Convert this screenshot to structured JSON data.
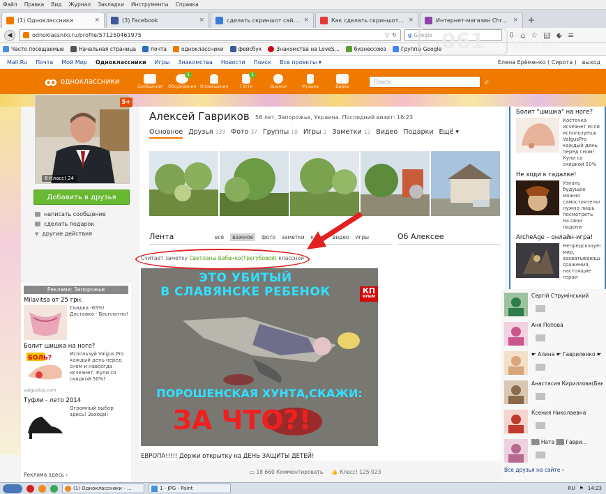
{
  "menubar": [
    "Файл",
    "Правка",
    "Вид",
    "Журнал",
    "Закладки",
    "Инструменты",
    "Справка"
  ],
  "tabs": [
    {
      "label": "(1) Одноклассники",
      "color": "#f07a00",
      "active": true
    },
    {
      "label": "(3) Facebook",
      "color": "#3b5998"
    },
    {
      "label": "сделать скриншот сайта це...",
      "color": "#3a7bd5"
    },
    {
      "label": "Как сделать скриншот цело...",
      "color": "#e53935"
    },
    {
      "label": "Интернет-магазин Chrome - ...",
      "color": "#8e44ad"
    }
  ],
  "navbar": {
    "url": "odnoklassniki.ru/profile/571250461975",
    "search_placeholder": "Google"
  },
  "bookmarks": [
    {
      "label": "Часто посещаемые",
      "color": "#4a90d9"
    },
    {
      "label": "Начальная страница",
      "color": "#555"
    },
    {
      "label": "почта",
      "color": "#2a6ac0"
    },
    {
      "label": "одноклассники",
      "color": "#f07a00"
    },
    {
      "label": "фейсбук",
      "color": "#3b5998"
    },
    {
      "label": "Знакомства на LoveS...",
      "color": "#d0021b"
    },
    {
      "label": "бизнессоюз",
      "color": "#5a9e2f"
    },
    {
      "label": "Группы Google",
      "color": "#4285f4"
    }
  ],
  "watermark": {
    "logo": "061",
    "line1": "Сайт міста",
    "line2": "Запоріжжя"
  },
  "oktop": {
    "links": [
      "Mail.Ru",
      "Почта",
      "Мой Мир",
      "Одноклассники",
      "Игры",
      "Знакомства",
      "Новости",
      "Поиск",
      "Все проекты ▾"
    ],
    "user": "Елена Ерёменко ( Сирота )",
    "logout": "выход"
  },
  "okbar": {
    "logo": "одноклассники",
    "icons": [
      {
        "label": "Сообщения",
        "badge": ""
      },
      {
        "label": "Обсуждения",
        "badge": "1"
      },
      {
        "label": "Оповещения",
        "badge": ""
      },
      {
        "label": "Гости",
        "badge": "1"
      },
      {
        "label": "Оценки",
        "badge": ""
      },
      {
        "label": "Музыка",
        "badge": ""
      },
      {
        "label": "Видео",
        "badge": ""
      }
    ],
    "search_placeholder": "Поиск"
  },
  "profile": {
    "name": "Алексей Гавриков",
    "info": "58 лет, Запорожье, Украина. Последний визит: 16:23",
    "class_count": "8 Класс! 24",
    "badge": "5+",
    "add_friend": "Добавить в друзья",
    "actions": [
      "написать сообщение",
      "сделать подарок",
      "другие действия"
    ],
    "tabs": [
      {
        "label": "Основное",
        "count": ""
      },
      {
        "label": "Друзья",
        "count": "139"
      },
      {
        "label": "Фото",
        "count": "37"
      },
      {
        "label": "Группы",
        "count": "10"
      },
      {
        "label": "Игры",
        "count": "2"
      },
      {
        "label": "Заметки",
        "count": "12"
      },
      {
        "label": "Видео",
        "count": ""
      },
      {
        "label": "Подарки",
        "count": ""
      },
      {
        "label": "Ещё ▾",
        "count": ""
      }
    ]
  },
  "feed": {
    "title": "Лента",
    "filters": [
      "всё",
      "важное",
      "фото",
      "заметки",
      "класс",
      "видео",
      "игры"
    ],
    "about": "Об Алексее",
    "note_prefix": "Считает заметку ",
    "note_name": "Светланы Бабенко(Трегубовой)",
    "note_suffix": " классной",
    "post_text1": "ЭТО УБИТЫЙ",
    "post_text2": "В СЛАВЯНСКЕ РЕБЕНОК",
    "post_text3": "ПОРОШЕНСКАЯ ХУНТА,СКАЖИ:",
    "post_text4": "ЗА ЧТО?!",
    "kp_logo": "КП",
    "kp_sub": "КРЫМ",
    "caption": "ЕВРОПА!!!!! Держи открытку на ДЕНЬ ЗАЩИТЫ ДЕТЕЙ!",
    "comments": "18 660 Комментировать",
    "likes": "Класс! 125 023"
  },
  "left_ads": {
    "header": "Реклама: Запорожье",
    "items": [
      {
        "title": "Milavitsa от 25 грн.",
        "text": "Скидка -65%! Доставка - Бесплатно!",
        "color": "#e9a7b8"
      },
      {
        "title": "Болит шишка на ноге?",
        "text": "Используй Valgus Pro каждый день перед сном и навсегда исчезнет. Купи со скидкой 50%!",
        "color": "#f0a090"
      },
      {
        "title": "Туфли - лето 2014",
        "text": "Огромный выбор здесь! Заходи!",
        "color": "#333333"
      }
    ],
    "source": "valgusluv.com",
    "footer": "Реклама здесь ›"
  },
  "right_ads": [
    {
      "title": "Болит \"шишка\" на ноге?",
      "text": "Косточка исчезнет если используешь ValgusPro каждый день перед сном! Купи со скидкой 50%",
      "color": "#e7b49b"
    },
    {
      "title": "Не ходи к гадалке!",
      "text": "Узнать будущее можно самостоятельно, нужно лишь посмотреть на свои ладони",
      "color": "#9b4a1a"
    },
    {
      "title": "ArcheAge – онлайн-игра!",
      "text": "Непредсказуемый мир, захватывающие сражения, настоящие герои",
      "color": "#6b5a4a"
    }
  ],
  "friends": {
    "items": [
      {
        "name": "Сергій Струмінський",
        "color": "#2e7d4a"
      },
      {
        "name": "Аня Попова",
        "color": "#c9558a"
      },
      {
        "name": "☛ Алина ☛ Гавриленко ☛",
        "color": "#d9a57a"
      },
      {
        "name": "Анастасия Кириллова(Бак...",
        "color": "#8a6a4a"
      },
      {
        "name": "Ксения Николаевна",
        "color": "#c0392b"
      },
      {
        "name": "▒▒ Ната ▒▒ Гаври...",
        "color": "#b56a8f"
      }
    ],
    "all_link": "Все друзья на сайте ›"
  },
  "taskbar": {
    "items": [
      "(1) Одноклассники - ...",
      "1 - JPG - Paint"
    ],
    "lang": "RU",
    "clock": "14:23"
  }
}
